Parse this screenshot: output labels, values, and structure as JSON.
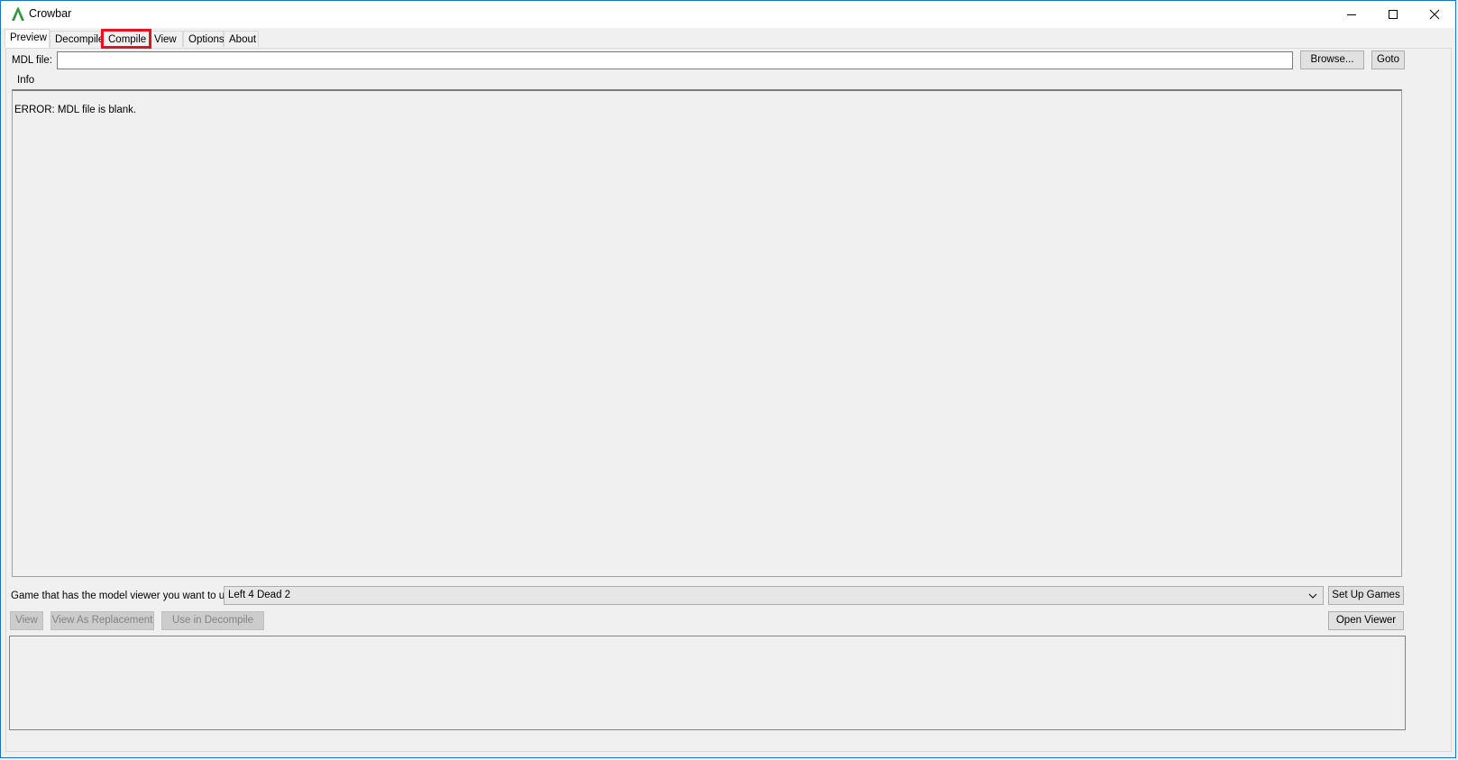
{
  "window": {
    "title": "Crowbar",
    "controls": {
      "minimize": "minimize-icon",
      "maximize": "maximize-icon",
      "close": "close-icon"
    }
  },
  "tabs": [
    {
      "label": "Preview",
      "active": true
    },
    {
      "label": "Decompile",
      "active": false
    },
    {
      "label": "Compile",
      "active": false,
      "highlighted": true
    },
    {
      "label": "View",
      "active": false
    },
    {
      "label": "Options",
      "active": false
    },
    {
      "label": "About",
      "active": false
    }
  ],
  "mdl": {
    "label": "MDL file:",
    "value": "",
    "browse_label": "Browse...",
    "goto_label": "Goto"
  },
  "info": {
    "title": "Info",
    "message": "ERROR: MDL file is blank."
  },
  "viewer": {
    "game_label": "Game that has the model viewer you want to use:",
    "game_selected": "Left 4 Dead 2",
    "setup_label": "Set Up Games",
    "view_label": "View",
    "view_replacement_label": "View As Replacement",
    "use_decompile_label": "Use in Decompile",
    "open_viewer_label": "Open Viewer"
  },
  "colors": {
    "accent_highlight": "#e3141c",
    "app_icon": "#2e9a3c"
  }
}
